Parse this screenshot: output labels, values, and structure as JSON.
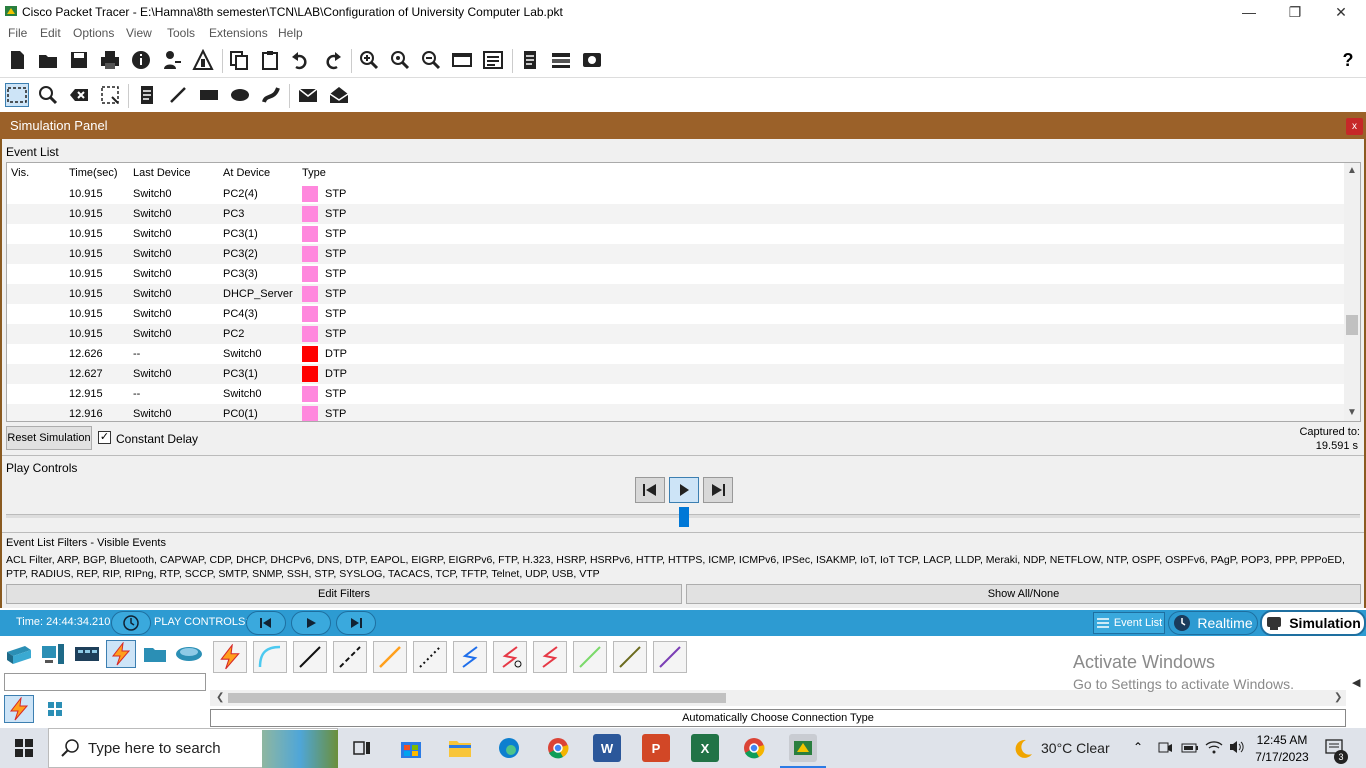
{
  "window": {
    "title": "Cisco Packet Tracer - E:\\Hamna\\8th semester\\TCN\\LAB\\Configuration of University Computer Lab.pkt"
  },
  "menu": [
    "File",
    "Edit",
    "Options",
    "View",
    "Tools",
    "Extensions",
    "Help"
  ],
  "toolbar": {
    "help_label": "?"
  },
  "simulation_panel": {
    "title": "Simulation Panel",
    "close_label": "x",
    "event_list_label": "Event List",
    "columns": [
      "Vis.",
      "Time(sec)",
      "Last Device",
      "At Device",
      "Type"
    ],
    "events": [
      {
        "time": "10.915",
        "last": "Switch0",
        "at": "PC2(4)",
        "type": "STP",
        "color": "#ff88dd"
      },
      {
        "time": "10.915",
        "last": "Switch0",
        "at": "PC3",
        "type": "STP",
        "color": "#ff88dd"
      },
      {
        "time": "10.915",
        "last": "Switch0",
        "at": "PC3(1)",
        "type": "STP",
        "color": "#ff88dd"
      },
      {
        "time": "10.915",
        "last": "Switch0",
        "at": "PC3(2)",
        "type": "STP",
        "color": "#ff88dd"
      },
      {
        "time": "10.915",
        "last": "Switch0",
        "at": "PC3(3)",
        "type": "STP",
        "color": "#ff88dd"
      },
      {
        "time": "10.915",
        "last": "Switch0",
        "at": "DHCP_Server",
        "type": "STP",
        "color": "#ff88dd"
      },
      {
        "time": "10.915",
        "last": "Switch0",
        "at": "PC4(3)",
        "type": "STP",
        "color": "#ff88dd"
      },
      {
        "time": "10.915",
        "last": "Switch0",
        "at": "PC2",
        "type": "STP",
        "color": "#ff88dd"
      },
      {
        "time": "12.626",
        "last": "--",
        "at": "Switch0",
        "type": "DTP",
        "color": "#ff0000"
      },
      {
        "time": "12.627",
        "last": "Switch0",
        "at": "PC3(1)",
        "type": "DTP",
        "color": "#ff0000"
      },
      {
        "time": "12.915",
        "last": "--",
        "at": "Switch0",
        "type": "STP",
        "color": "#ff88dd"
      },
      {
        "time": "12.916",
        "last": "Switch0",
        "at": "PC0(1)",
        "type": "STP",
        "color": "#ff88dd"
      }
    ],
    "reset_label": "Reset Simulation",
    "constant_delay_label": "Constant Delay",
    "constant_delay_checked": "✓",
    "captured_label": "Captured to:",
    "captured_value": "19.591 s",
    "play_controls_label": "Play Controls",
    "filters_title": "Event List Filters - Visible Events",
    "filters_list": "ACL Filter, ARP, BGP, Bluetooth, CAPWAP, CDP, DHCP, DHCPv6, DNS, DTP, EAPOL, EIGRP, EIGRPv6, FTP, H.323, HSRP, HSRPv6, HTTP, HTTPS, ICMP, ICMPv6, IPSec, ISAKMP, IoT, IoT TCP, LACP, LLDP, Meraki, NDP, NETFLOW, NTP, OSPF, OSPFv6, PAgP, POP3, PPP, PPPoED, PTP, RADIUS, REP, RIP, RIPng, RTP, SCCP, SMTP, SNMP, SSH, STP, SYSLOG, TACACS, TCP, TFTP, Telnet, UDP, USB, VTP",
    "edit_filters_label": "Edit Filters",
    "show_all_label": "Show All/None"
  },
  "statusbar": {
    "time_label": "Time: 24:44:34.210",
    "play_controls_label": "PLAY CONTROLS:",
    "event_list_label": "Event List",
    "realtime_label": "Realtime",
    "simulation_label": "Simulation"
  },
  "device_panel": {
    "connection_type_label": "Automatically Choose Connection Type"
  },
  "watermark": {
    "line1": "Activate Windows",
    "line2": "Go to Settings to activate Windows."
  },
  "taskbar": {
    "search_placeholder": "Type here to search",
    "weather": "30°C  Clear",
    "time": "12:45 AM",
    "date": "7/17/2023",
    "notification_count": "3"
  }
}
